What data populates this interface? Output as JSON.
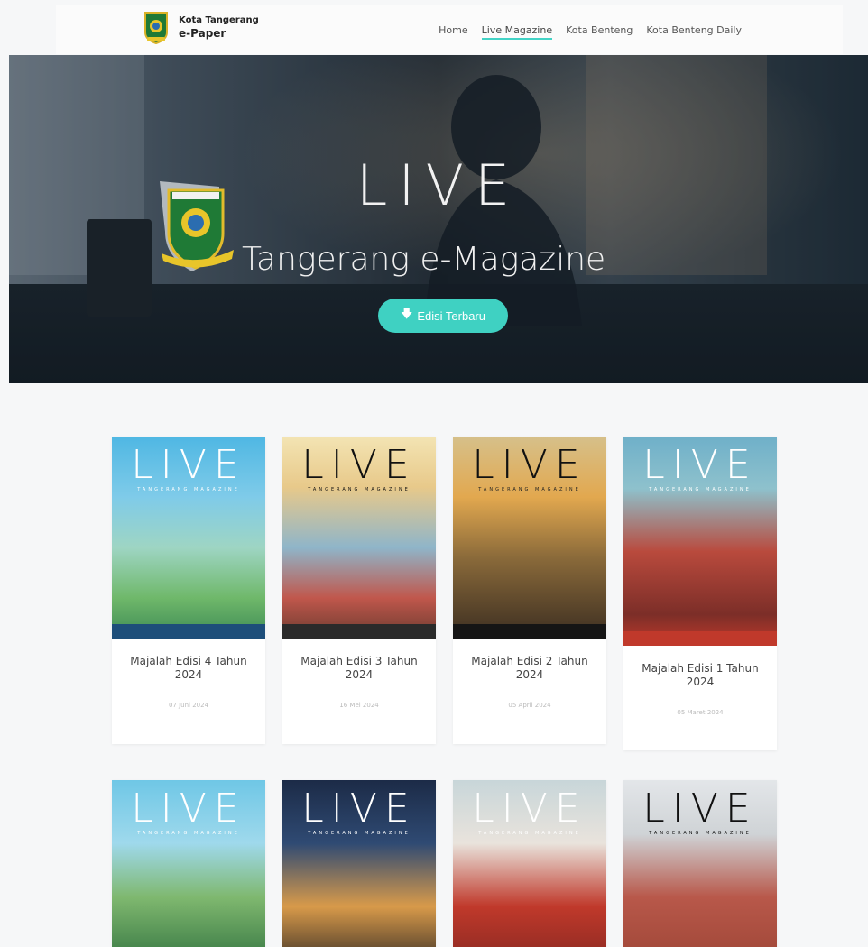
{
  "header": {
    "brand_line1": "Kota Tangerang",
    "brand_line2": "e-Paper",
    "nav": [
      {
        "label": "Home"
      },
      {
        "label": "Live Magazine",
        "active": true
      },
      {
        "label": "Kota Benteng"
      },
      {
        "label": "Kota Benteng Daily"
      }
    ]
  },
  "hero": {
    "title": "LIVE",
    "subtitle": "Tangerang e-Magazine",
    "button_label": "Edisi Terbaru",
    "button_icon": "arrow-down-icon"
  },
  "cover_masthead": "LIVE",
  "cover_tagline": "TANGERANG MAGAZINE",
  "magazines": [
    {
      "title": "Majalah Edisi 4 Tahun 2024",
      "date": "07 Juni 2024"
    },
    {
      "title": "Majalah Edisi 3 Tahun 2024",
      "date": "16 Mei 2024"
    },
    {
      "title": "Majalah Edisi 2 Tahun 2024",
      "date": "05 April 2024"
    },
    {
      "title": "Majalah Edisi 1 Tahun 2024",
      "date": "05 Maret 2024"
    }
  ],
  "colors": {
    "accent": "#3fd1c2",
    "background": "#f6f7f8"
  }
}
